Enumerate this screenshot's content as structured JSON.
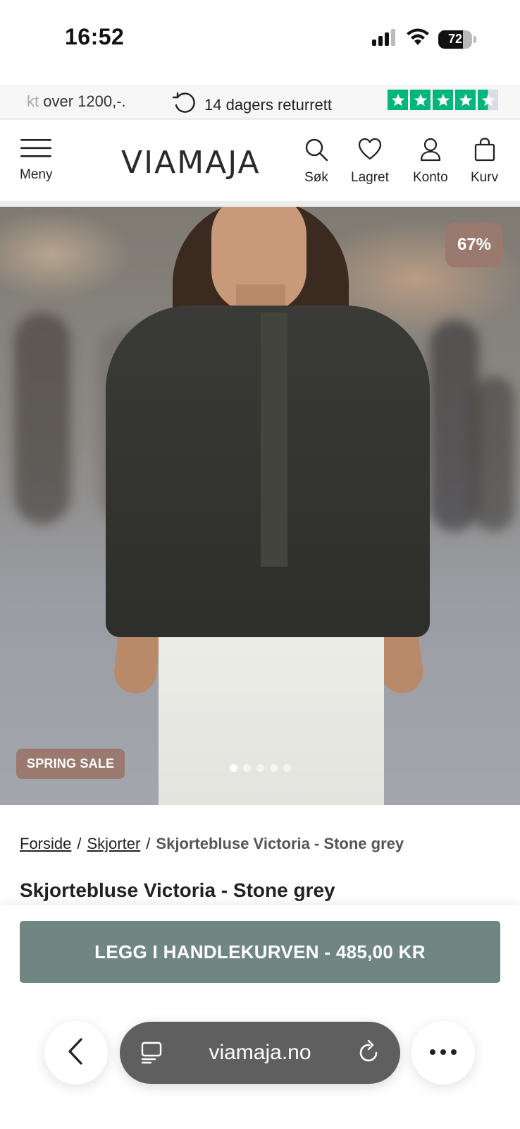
{
  "status_bar": {
    "time": "16:52",
    "battery": "72",
    "battery_level": 0.72
  },
  "usp_bar": {
    "free_shipping_fade": "kt",
    "free_shipping": " over 1200,-.",
    "returns": "14 dagers returrett",
    "trustpilot_rating": 4.5
  },
  "header": {
    "menu_label": "Meny",
    "logo": "VIAMAJA",
    "search_label": "Søk",
    "saved_label": "Lagret",
    "account_label": "Konto",
    "cart_label": "Kurv"
  },
  "hero": {
    "discount": "67%",
    "sale_label": "SPRING SALE",
    "image_count": 5,
    "active_image": 1
  },
  "breadcrumb": {
    "home": "Forside",
    "separator": "/",
    "category": "Skjorter",
    "current": "Skjortebluse Victoria - Stone grey"
  },
  "product": {
    "title": "Skjortebluse Victoria - Stone grey"
  },
  "cart": {
    "button_label": "LEGG I HANDLEKURVEN - 485,00 KR"
  },
  "browser": {
    "url": "viamaja.no"
  },
  "colors": {
    "accent": "#6f8683",
    "badge": "#9a7a6e",
    "trustpilot": "#00b67a"
  }
}
